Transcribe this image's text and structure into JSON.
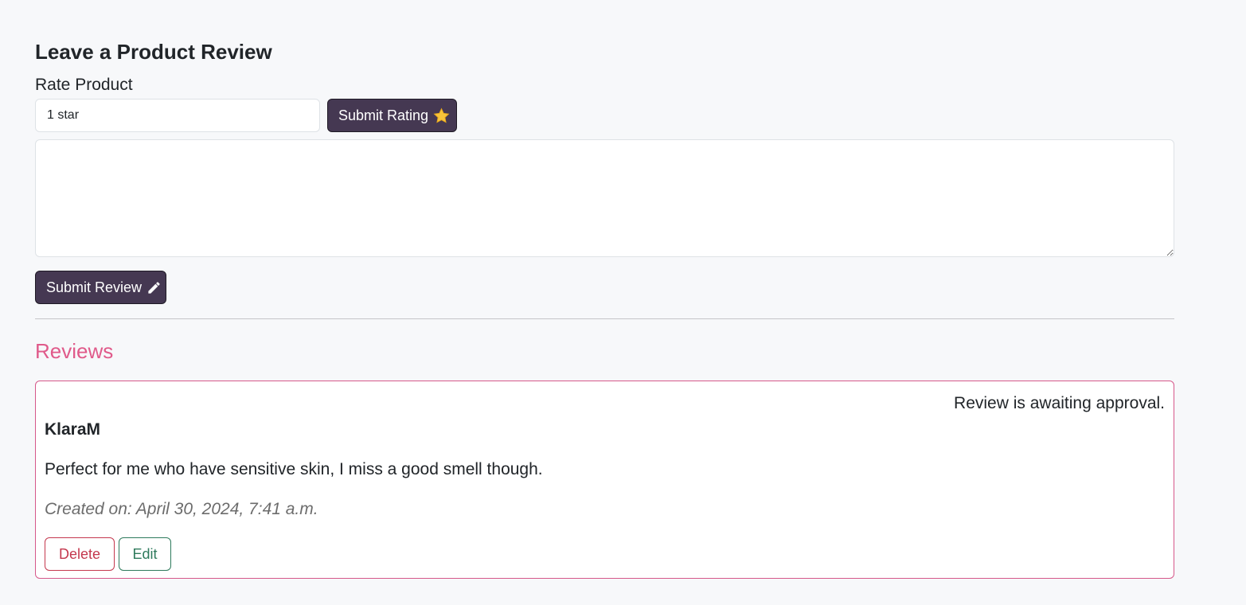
{
  "form": {
    "title": "Leave a Product Review",
    "rate_label": "Rate Product",
    "rating_selected": "1 star",
    "submit_rating_label": "Submit Rating",
    "submit_rating_icon": "star-icon",
    "review_text": "",
    "submit_review_label": "Submit Review",
    "submit_review_icon": "pencil-icon"
  },
  "reviews": {
    "heading": "Reviews",
    "items": [
      {
        "status": "Review is awaiting approval.",
        "author": "KlaraM",
        "body": "Perfect for me who have sensitive skin, I miss a good smell though.",
        "created": "Created on: April 30, 2024, 7:41 a.m.",
        "delete_label": "Delete",
        "edit_label": "Edit"
      }
    ]
  },
  "colors": {
    "primary_button": "#453852",
    "reviews_accent": "#e05a8a",
    "card_border": "#d6588a",
    "delete": "#c4384e",
    "edit": "#2e7a5c",
    "page_background": "#f7f8fa"
  }
}
